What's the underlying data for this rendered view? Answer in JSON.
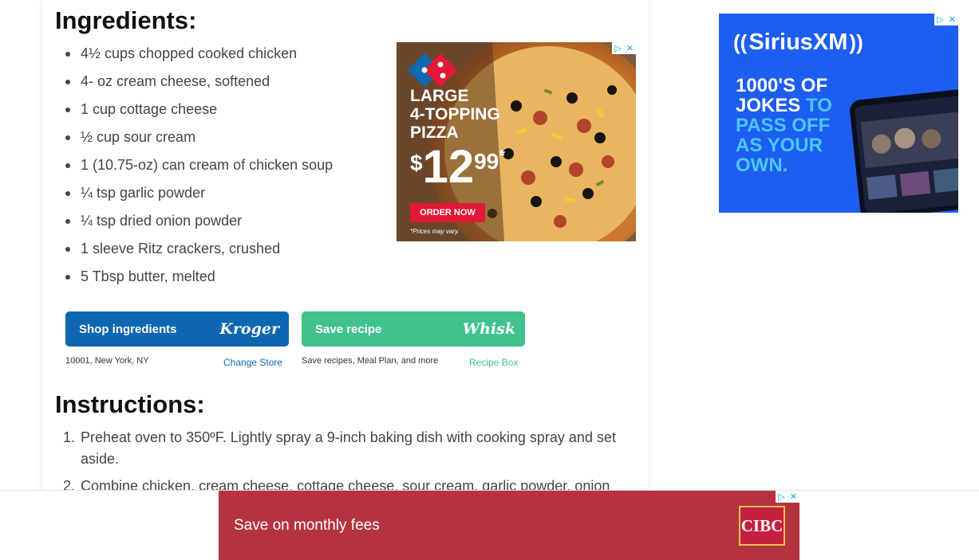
{
  "ingredients": {
    "title": "Ingredients:",
    "items": [
      "4½ cups chopped cooked chicken",
      "4- oz cream cheese, softened",
      "1 cup cottage cheese",
      "½ cup sour cream",
      "1 (10.75-oz) can cream of chicken soup",
      "¼ tsp garlic powder",
      "¼ tsp dried onion powder",
      "1 sleeve Ritz crackers, crushed",
      "5 Tbsp butter, melted"
    ]
  },
  "shop": {
    "label": "Shop ingredients",
    "brand": "Kroger",
    "location": "10001, New York, NY",
    "change_store": "Change Store"
  },
  "save": {
    "label": "Save recipe",
    "brand": "Whisk",
    "note": "Save recipes, Meal Plan, and more",
    "recipe_box": "Recipe Box"
  },
  "instructions": {
    "title": "Instructions:",
    "steps": [
      {
        "num": "1.",
        "text": "Preheat oven to 350ºF. Lightly spray a 9-inch baking dish with cooking spray and set aside."
      },
      {
        "num": "2.",
        "text": "Combine chicken, cream cheese, cottage cheese, sour cream, garlic powder, onion"
      }
    ]
  },
  "ads": {
    "pizza": {
      "line1": "LARGE",
      "line2": "4-TOPPING",
      "line3": "PIZZA",
      "price_dollar": "$",
      "price_main": "12",
      "price_cents": "99",
      "price_star": "*",
      "cta": "ORDER NOW",
      "fine_print": "*Prices may vary."
    },
    "sirius": {
      "brand": "SiriusXM",
      "line1": "1000'S OF",
      "line2a": "JOKES",
      "line2b": "TO",
      "line3": "PASS OFF",
      "line4": "AS YOUR",
      "line5": "OWN."
    },
    "cibc": {
      "text": "Save on monthly fees",
      "logo": "CIBC"
    }
  },
  "colors": {
    "kroger_blue": "#0c67b0",
    "whisk_green": "#3fc28c",
    "sirius_blue": "#1c5ef0",
    "cibc_red": "#b5323f"
  }
}
